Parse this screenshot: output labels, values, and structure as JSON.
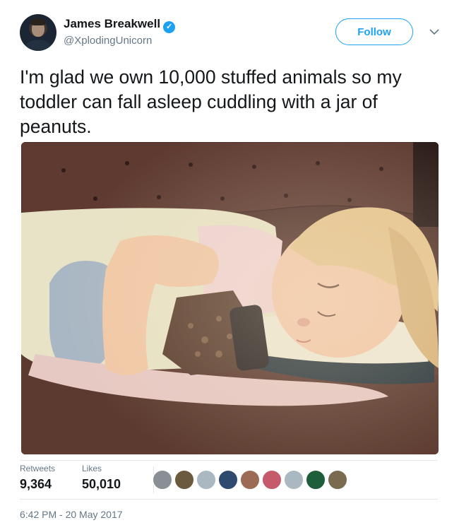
{
  "tweet": {
    "author_name": "James Breakwell",
    "author_handle": "@XplodingUnicorn",
    "verified_glyph": "✓",
    "follow_label": "Follow",
    "text": "I'm glad we own 10,000 stuffed animals so my toddler can fall asleep cuddling with a jar of peanuts.",
    "stats": {
      "retweets_label": "Retweets",
      "retweets_value": "9,364",
      "likes_label": "Likes",
      "likes_value": "50,010"
    },
    "timestamp": "6:42 PM - 20 May 2017",
    "liker_avatars": [
      {
        "name": "liker-avatar-1",
        "color": "#8a8f95"
      },
      {
        "name": "liker-avatar-2",
        "color": "#6b5a3e"
      },
      {
        "name": "liker-avatar-3",
        "color": "#aab8c2"
      },
      {
        "name": "liker-avatar-4",
        "color": "#2f4a6e"
      },
      {
        "name": "liker-avatar-5",
        "color": "#9b6b55"
      },
      {
        "name": "liker-avatar-6",
        "color": "#c45a6a"
      },
      {
        "name": "liker-avatar-7",
        "color": "#aab8c2"
      },
      {
        "name": "liker-avatar-8",
        "color": "#1f5e3a"
      },
      {
        "name": "liker-avatar-9",
        "color": "#7a6a50"
      }
    ]
  },
  "icons": {
    "verified": "verified-badge-icon",
    "chevron": "chevron-down-icon"
  },
  "colors": {
    "accent": "#1da1f2",
    "secondary_text": "#657786",
    "primary_text": "#14171a"
  }
}
